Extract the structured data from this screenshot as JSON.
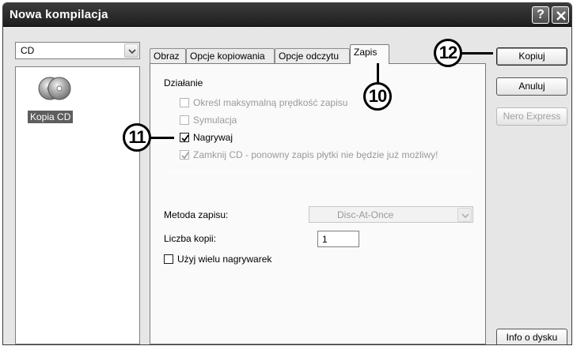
{
  "window": {
    "title": "Nowa kompilacja",
    "help_glyph": "?",
    "close_icon": "close-icon"
  },
  "left_panel": {
    "type_select": {
      "value": "CD"
    },
    "compilation_list": {
      "items": [
        {
          "label": "Kopia CD",
          "icon": "cd-copy-icon",
          "selected": true
        }
      ]
    }
  },
  "tabs": [
    {
      "label": "Obraz"
    },
    {
      "label": "Opcje kopiowania"
    },
    {
      "label": "Opcje odczytu"
    },
    {
      "label": "Zapis",
      "active": true
    }
  ],
  "zapis_panel": {
    "group_label": "Działanie",
    "options": [
      {
        "label": "Określ maksymalną prędkość zapisu",
        "checked": false,
        "enabled": false
      },
      {
        "label": "Symulacja",
        "checked": false,
        "enabled": false
      },
      {
        "label": "Nagrywaj",
        "checked": true,
        "enabled": true
      },
      {
        "label": "Zamknij CD - ponowny zapis płytki nie będzie już możliwy!",
        "checked": true,
        "enabled": false
      }
    ],
    "write_method_label": "Metoda zapisu:",
    "write_method_value": "Disc-At-Once",
    "copies_label": "Liczba kopii:",
    "copies_value": "1",
    "multi_recorder_label": "Użyj wielu nagrywarek",
    "multi_recorder_checked": false
  },
  "buttons": {
    "copy": "Kopiuj",
    "cancel": "Anuluj",
    "nero_express": "Nero Express",
    "disc_info": "Info o dysku"
  },
  "callouts": {
    "c10": "10",
    "c11": "11",
    "c12": "12"
  },
  "colors": {
    "titlebar": "#2a2a2a",
    "selection": "#5e5e5e"
  }
}
